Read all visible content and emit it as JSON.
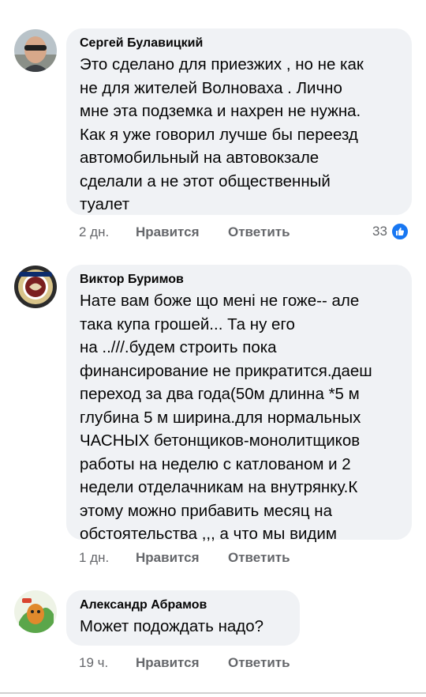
{
  "comments": [
    {
      "author": "Сергей Булавицкий",
      "lines": [
        "Это сделано для приезжих , но не как",
        "не для жителей Волноваха . Лично",
        "мне эта подземка и нахрен не нужна.",
        "Как я уже говорил лучше бы переезд",
        "автомобильный на автовокзале",
        "сделали а не этот общественный",
        "туалет"
      ],
      "time": "2 дн.",
      "like_label": "Нравится",
      "reply_label": "Ответить",
      "reaction_count": "33",
      "reaction_icon": "like-icon"
    },
    {
      "author": "Виктор Буримов",
      "lines": [
        "Нате вам боже що мені не гоже-- але",
        "така купа грошей... Та ну его",
        "на ..///.будем строить пока",
        "финансирование не прикратится.даеш",
        "переход за два года(50м длинна *5 м",
        "глубина 5 м ширина.для нормальных",
        "ЧАСНЫХ бетонщиков-монолитщиков",
        "работы на неделю с катлованом и 2",
        "недели отделачникам на внутрянку.К",
        "этому можно прибавить месяц на",
        "обстоятельства ,,, а что мы видим"
      ],
      "time": "1 дн.",
      "like_label": "Нравится",
      "reply_label": "Ответить"
    },
    {
      "author": "Александр Абрамов",
      "lines": [
        "Может подождать надо?"
      ],
      "time": "19 ч.",
      "like_label": "Нравится",
      "reply_label": "Ответить"
    }
  ],
  "colors": {
    "bubble": "#f0f2f5",
    "secondary_text": "#65676b",
    "like_blue": "#1877f2"
  }
}
